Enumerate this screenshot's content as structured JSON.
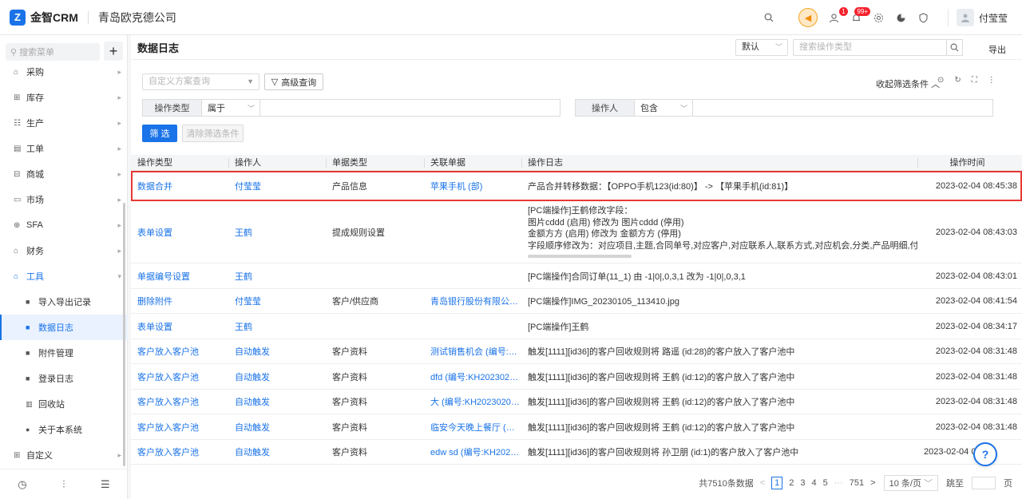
{
  "app": {
    "logo_glyph": "Z",
    "name": "金智CRM",
    "company": "青岛欧克德公司"
  },
  "topbar": {
    "icons": [
      "search-icon",
      "notice-icon",
      "message-icon",
      "bell-icon",
      "settings-icon",
      "pie-chart-icon",
      "shield-icon"
    ],
    "badges": {
      "message": "1",
      "bell": "99+"
    },
    "user": {
      "name": "付莹莹"
    }
  },
  "sidebar": {
    "search_placeholder": "搜索菜单",
    "add_label": "+",
    "items": [
      {
        "label": "采购",
        "icon": "cart-icon"
      },
      {
        "label": "库存",
        "icon": "warehouse-icon"
      },
      {
        "label": "生产",
        "icon": "production-icon"
      },
      {
        "label": "工单",
        "icon": "ticket-icon"
      },
      {
        "label": "商城",
        "icon": "store-icon"
      },
      {
        "label": "市场",
        "icon": "market-icon"
      },
      {
        "label": "SFA",
        "icon": "sfa-icon"
      },
      {
        "label": "财务",
        "icon": "finance-icon"
      },
      {
        "label": "工具",
        "icon": "tool-icon"
      }
    ],
    "sub_items": [
      {
        "label": "导入导出记录"
      },
      {
        "label": "数据日志"
      },
      {
        "label": "附件管理"
      },
      {
        "label": "登录日志"
      },
      {
        "label": "回收站"
      },
      {
        "label": "关于本系统"
      }
    ],
    "last_item": {
      "label": "自定义"
    },
    "bottom_icons": [
      "history-icon",
      "filter-settings-icon",
      "menu-list-icon"
    ]
  },
  "page": {
    "title": "数据日志",
    "view_select": "默认",
    "search_placeholder": "搜索操作类型",
    "export_label": "导出"
  },
  "filter": {
    "plan_placeholder": "自定义方案查询",
    "advanced_label": "高级查询",
    "collapse_label": "收起筛选条件",
    "cond1": {
      "field": "操作类型",
      "operator": "属于"
    },
    "cond2": {
      "field": "操作人",
      "operator": "包含"
    },
    "filter_btn": "筛 选",
    "clear_btn": "清除筛选条件"
  },
  "table": {
    "headers": [
      "操作类型",
      "操作人",
      "单据类型",
      "关联单据",
      "操作日志",
      "操作时间"
    ],
    "rows": [
      {
        "type": "数据合并",
        "user": "付莹莹",
        "doc_type": "产品信息",
        "related": "苹果手机 (部)",
        "log": "产品合并转移数据：【OPPO手机123(id:80)】 -> 【苹果手机(id:81)】",
        "time": "2023-02-04 08:45:38"
      },
      {
        "type": "表单设置",
        "user": "王鹤",
        "doc_type": "提成规则设置",
        "related": "",
        "log_lines": [
          "[PC端操作]王鹤修改字段：",
          "图片cddd (启用) 修改为 图片cddd (停用)",
          "金额方方 (启用) 修改为 金额方方 (停用)",
          "字段顺序修改为：对应项目,主题,合同单号,对应客户,对应联系人,联系方式,对应机会,分类,产品明细,付款方式,签单日期"
        ],
        "time": "2023-02-04 08:43:03"
      },
      {
        "type": "单据编号设置",
        "user": "王鹤",
        "doc_type": "",
        "related": "",
        "log": "[PC端操作]合同订单(11_1) 由 -1|0|,0,3,1 改为 -1|0|,0,3,1",
        "time": "2023-02-04 08:43:01"
      },
      {
        "type": "删除附件",
        "user": "付莹莹",
        "doc_type": "客户/供应商",
        "related": "青岛银行股份有限公司青...",
        "log": "[PC端操作]IMG_20230105_113410.jpg",
        "time": "2023-02-04 08:41:54"
      },
      {
        "type": "表单设置",
        "user": "王鹤",
        "doc_type": "",
        "related": "",
        "log": "[PC端操作]王鹤",
        "time": "2023-02-04 08:34:17"
      },
      {
        "type": "客户放入客户池",
        "user": "自动触发",
        "doc_type": "客户资料",
        "related": "测试销售机会 (编号:KH20...",
        "log": "触发[1111][id36]的客户回收规则将 路遥 (id:28)的客户放入了客户池中",
        "time": "2023-02-04 08:31:48"
      },
      {
        "type": "客户放入客户池",
        "user": "自动触发",
        "doc_type": "客户资料",
        "related": "dfd (编号:KH2023020212...",
        "log": "触发[1111][id36]的客户回收规则将 王鹤 (id:12)的客户放入了客户池中",
        "time": "2023-02-04 08:31:48"
      },
      {
        "type": "客户放入客户池",
        "user": "自动触发",
        "doc_type": "客户资料",
        "related": "大 (编号:KH20230202120...",
        "log": "触发[1111][id36]的客户回收规则将 王鹤 (id:12)的客户放入了客户池中",
        "time": "2023-02-04 08:31:48"
      },
      {
        "type": "客户放入客户池",
        "user": "自动触发",
        "doc_type": "客户资料",
        "related": "临安今天晚上餐厅 (编号:...",
        "log": "触发[1111][id36]的客户回收规则将 王鹤 (id:12)的客户放入了客户池中",
        "time": "2023-02-04 08:31:48"
      },
      {
        "type": "客户放入客户池",
        "user": "自动触发",
        "doc_type": "客户资料",
        "related": "edw sd (编号:KH2023020...",
        "log": "触发[1111][id36]的客户回收规则将 孙卫朋 (id:1)的客户放入了客户池中",
        "time": "2023-02-04 0"
      }
    ]
  },
  "pager": {
    "total": "共7510条数据",
    "prev": "<",
    "pages": [
      "1",
      "2",
      "3",
      "4",
      "5"
    ],
    "ellipsis": "···",
    "last": "751",
    "next": ">",
    "page_size": "10 条/页",
    "jump_label": "跳至",
    "page_unit": "页"
  },
  "help": {
    "label": "?"
  },
  "colors": {
    "accent": "#1a73e8",
    "highlight_border": "#e53935"
  }
}
